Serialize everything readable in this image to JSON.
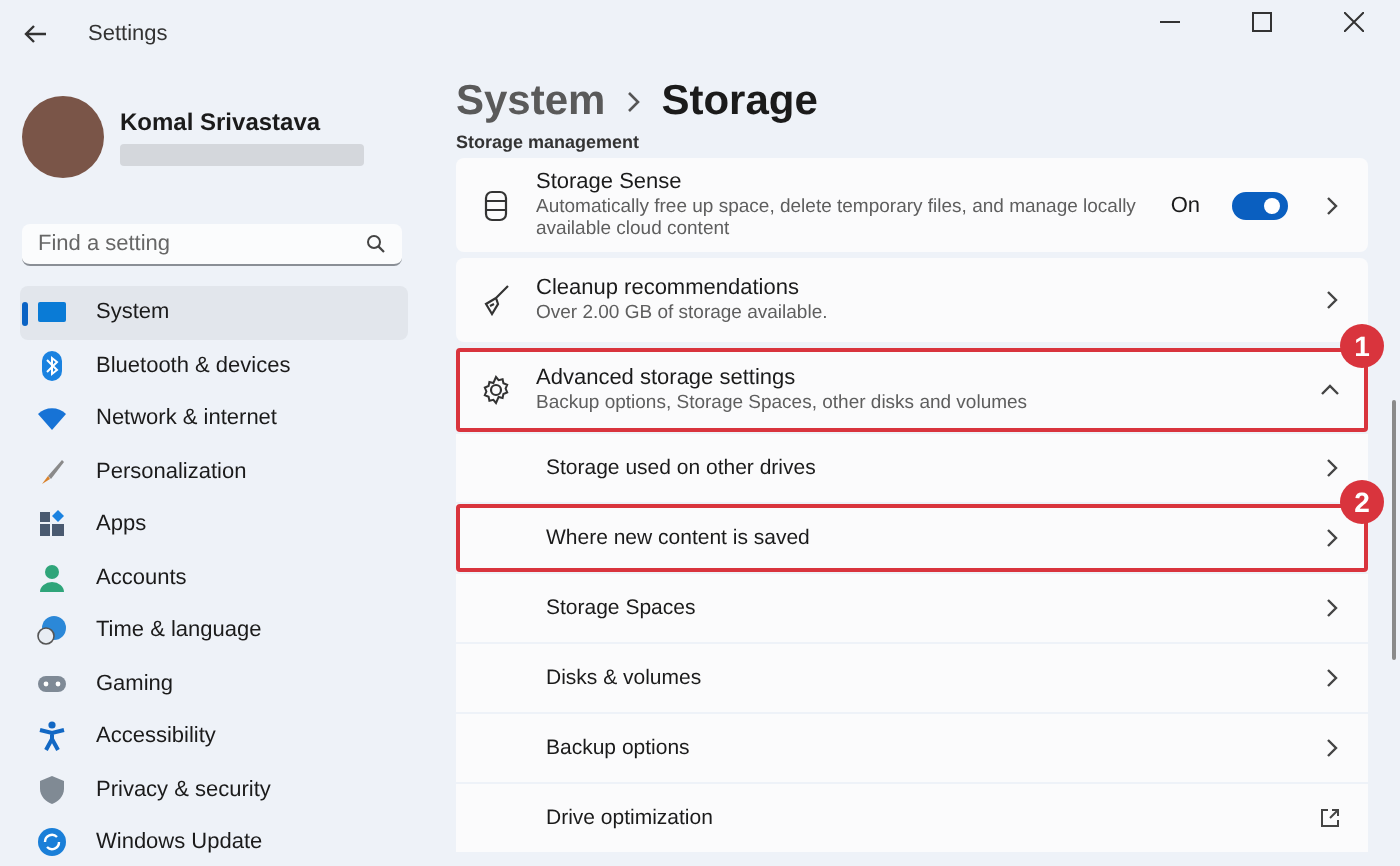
{
  "window": {
    "title": "Settings"
  },
  "account": {
    "name": "Komal Srivastava"
  },
  "search": {
    "placeholder": "Find a setting"
  },
  "nav": [
    {
      "label": "System",
      "selected": true
    },
    {
      "label": "Bluetooth & devices",
      "selected": false
    },
    {
      "label": "Network & internet",
      "selected": false
    },
    {
      "label": "Personalization",
      "selected": false
    },
    {
      "label": "Apps",
      "selected": false
    },
    {
      "label": "Accounts",
      "selected": false
    },
    {
      "label": "Time & language",
      "selected": false
    },
    {
      "label": "Gaming",
      "selected": false
    },
    {
      "label": "Accessibility",
      "selected": false
    },
    {
      "label": "Privacy & security",
      "selected": false
    },
    {
      "label": "Windows Update",
      "selected": false
    }
  ],
  "breadcrumb": {
    "parent": "System",
    "current": "Storage"
  },
  "section_title": "Storage management",
  "cards": [
    {
      "kind": "toggle",
      "title": "Storage Sense",
      "description": "Automatically free up space, delete temporary files, and manage locally available cloud content",
      "toggle_label": "On",
      "on": true
    },
    {
      "kind": "link",
      "title": "Cleanup recommendations",
      "description": "Over 2.00 GB of storage available."
    },
    {
      "kind": "expander",
      "title": "Advanced storage settings",
      "description": "Backup options, Storage Spaces, other disks and volumes",
      "expanded": true,
      "callout": "1",
      "children": [
        {
          "label": "Storage used on other drives",
          "kind": "chevron"
        },
        {
          "label": "Where new content is saved",
          "kind": "chevron",
          "callout": "2"
        },
        {
          "label": "Storage Spaces",
          "kind": "chevron"
        },
        {
          "label": "Disks & volumes",
          "kind": "chevron"
        },
        {
          "label": "Backup options",
          "kind": "chevron"
        },
        {
          "label": "Drive optimization",
          "kind": "external"
        }
      ]
    }
  ]
}
